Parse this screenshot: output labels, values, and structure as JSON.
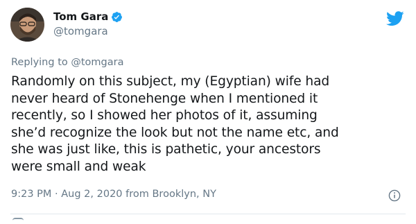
{
  "tweet": {
    "author": {
      "display_name": "Tom Gara",
      "handle": "@tomgara",
      "verified": true
    },
    "reply_to": "Replying to @tomgara",
    "text_lines": [
      "Randomly on this subject, my (Egyptian) wife had",
      "never heard of Stonehenge when I mentioned it",
      "recently, so I showed her photos of it, assuming",
      "she’d recognize the look but not the name etc, and",
      "she was just like, this is pathetic, your ancestors",
      "were small and weak"
    ],
    "meta": "9:23 PM · Aug 2, 2020 from Brooklyn, NY"
  },
  "colors": {
    "twitter_blue": "#1da1f2",
    "secondary_text": "#657786",
    "primary_text": "#14171a"
  },
  "icons": {
    "brand": "twitter-bird-icon",
    "verified": "verified-badge-icon",
    "info": "info-icon"
  }
}
